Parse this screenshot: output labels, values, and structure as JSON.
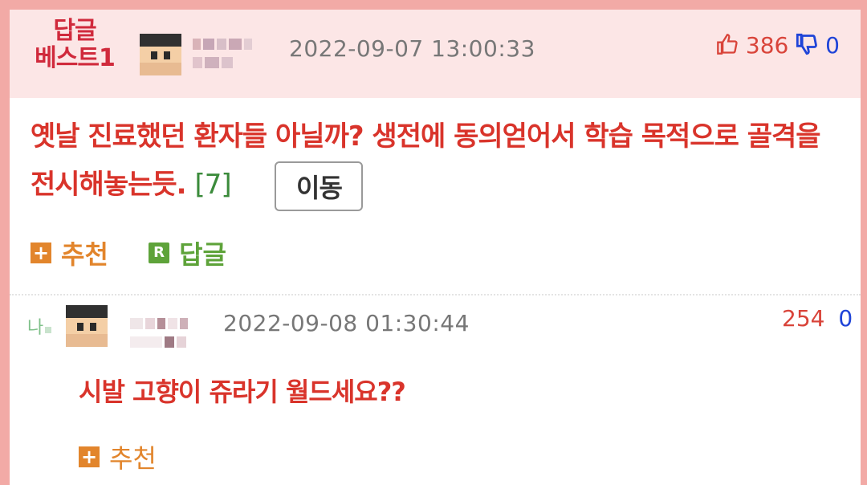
{
  "best_comment": {
    "badge_line1": "답글",
    "badge_line2": "베스트1",
    "datetime": "2022-09-07 13:00:33",
    "upvotes": "386",
    "downvotes": "0",
    "text": "옛날 진료했던 환자들 아닐까? 생전에 동의얻어서 학습 목적으로 골격을 전시해놓는듯.",
    "reply_count": "[7]",
    "move_button": "이동",
    "recommend_label": "추천",
    "recommend_icon": "+",
    "reply_label": "답글",
    "reply_icon": "R"
  },
  "reply": {
    "indicator": "나",
    "datetime": "2022-09-08 01:30:44",
    "upvotes": "254",
    "downvotes": "0",
    "text": "시발 고향이 쥬라기 월드세요??",
    "recommend_label": "추천",
    "recommend_icon": "+"
  },
  "colors": {
    "frame": "#f2aaa6",
    "header_bg": "#fce6e6",
    "comment_red": "#d9342b",
    "badge_red": "#d02a3c",
    "recommend_orange": "#e2852c",
    "reply_green": "#5ea33a",
    "down_blue": "#1f44d8"
  },
  "icons": {
    "thumb_up": "thumbs-up-icon",
    "thumb_down": "thumbs-down-icon",
    "reply_arrow": "reply-indicator-icon"
  }
}
